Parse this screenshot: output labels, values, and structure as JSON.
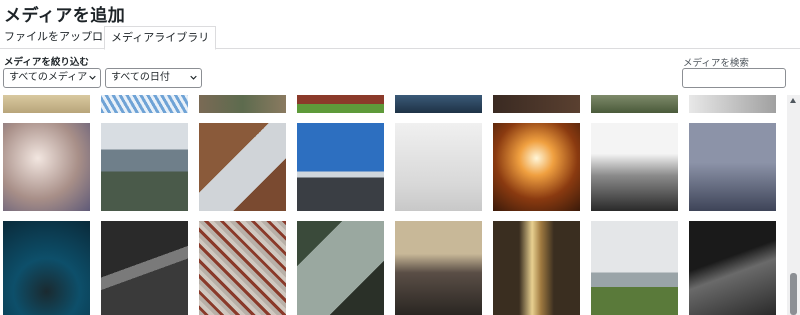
{
  "header": {
    "title": "メディアを追加"
  },
  "tabs": [
    {
      "label": "ファイルをアップロード",
      "active": false
    },
    {
      "label": "メディアライブラリ",
      "active": true
    }
  ],
  "filters": {
    "label": "メディアを絞り込む",
    "type_select": {
      "value": "すべてのメディア"
    },
    "date_select": {
      "value": "すべての日付"
    }
  },
  "search": {
    "label": "メディアを検索",
    "value": ""
  },
  "grid": {
    "rows": [
      [
        "dry-grass",
        "ferris-wheel",
        "rocky-ground",
        "red-brick-grass",
        "lake-feet",
        "dark-wood",
        "hillside",
        "laptop-keys"
      ],
      [
        "hand-coffee",
        "mountain-lake",
        "laptop-desk",
        "highway-windmills",
        "white-desk",
        "building-spiral",
        "misty-forest",
        "ocean-fog"
      ],
      [
        "underwater-swimmer",
        "forest-road",
        "love-locks",
        "ereader",
        "mountain-dusk",
        "escalator",
        "farm-mountain",
        "sewing-machine"
      ]
    ]
  },
  "colors": {
    "accent": "#2271b1",
    "border": "#dcdcde",
    "text": "#1d2327"
  }
}
